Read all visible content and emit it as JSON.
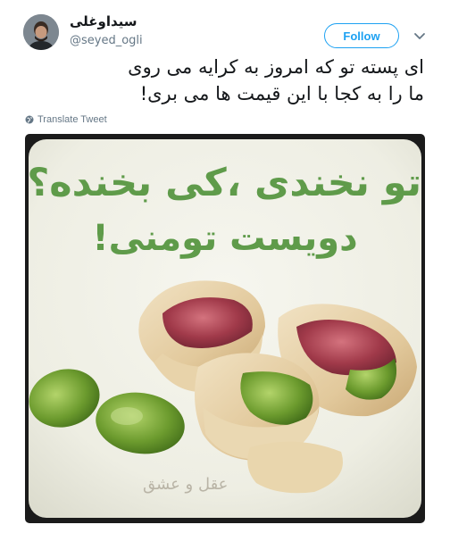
{
  "tweet": {
    "author_name": "سیداوغلی",
    "author_handle": "@seyed_ogli",
    "follow_label": "Follow",
    "text_lines": [
      "ای پسته تو که امروز به کرایه می روی",
      "ما را به کجا با این قیمت ها می بری!"
    ],
    "translate_label": "Translate Tweet"
  },
  "media": {
    "caption_line_1": "تو نخندی ،کی بخنده؟",
    "caption_line_2": "دویست تومنی!",
    "watermark": "عقل و عشق"
  },
  "colors": {
    "accent": "#1da1f2",
    "text": "#14171a",
    "secondary": "#657786",
    "image_green_text": "#5f9b4a"
  },
  "icons": {
    "chevron": "chevron-down-icon",
    "translate": "globe-icon"
  }
}
